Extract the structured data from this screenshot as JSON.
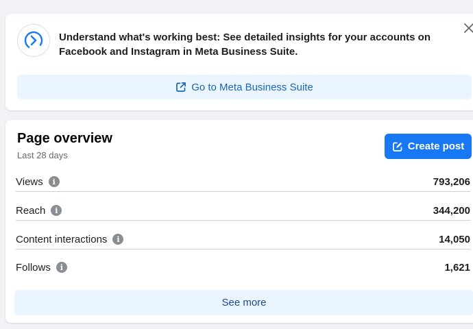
{
  "banner": {
    "icon": "meta-business-suite-logo",
    "message": "Understand what's working best: See detailed insights for your accounts on Facebook and Instagram in Meta Business Suite.",
    "cta_label": "Go to Meta Business Suite",
    "cta_icon": "external-link-icon",
    "close_icon": "close-icon"
  },
  "overview": {
    "title": "Page overview",
    "subtitle": "Last 28 days",
    "create_label": "Create post",
    "create_icon": "edit-icon",
    "metrics": [
      {
        "label": "Views",
        "value": "793,206",
        "icon": "info-icon"
      },
      {
        "label": "Reach",
        "value": "344,200",
        "icon": "info-icon"
      },
      {
        "label": "Content interactions",
        "value": "14,050",
        "icon": "info-icon"
      },
      {
        "label": "Follows",
        "value": "1,621",
        "icon": "info-icon"
      }
    ],
    "see_more_label": "See more"
  },
  "colors": {
    "primary": "#1877f2",
    "link_blue": "#1a66b8",
    "light_button_bg": "#ebf5ff",
    "page_bg": "#f0f2f5"
  }
}
